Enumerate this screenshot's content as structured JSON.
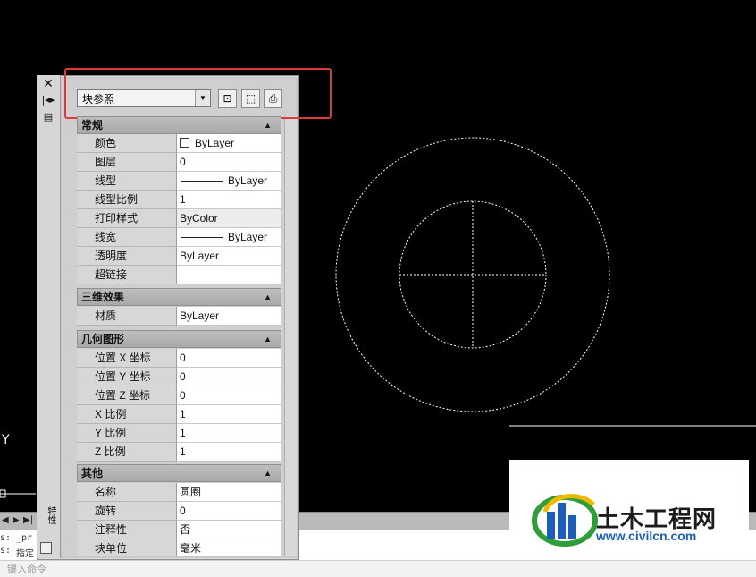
{
  "canvas": {
    "axis_label": "Y"
  },
  "palette": {
    "vertical_title": "特性",
    "object_type_select": "块参照",
    "toolbar": {
      "quick_select_icon": "quick-select-icon",
      "select_objects_icon": "select-objects-icon",
      "toggle_pickadd_icon": "toggle-pickadd-icon"
    },
    "sections": [
      {
        "title": "常规",
        "rows": [
          {
            "name": "颜色",
            "value": "ByLayer"
          },
          {
            "name": "图层",
            "value": "0"
          },
          {
            "name": "线型",
            "value": "ByLayer"
          },
          {
            "name": "线型比例",
            "value": "1"
          },
          {
            "name": "打印样式",
            "value": "ByColor"
          },
          {
            "name": "线宽",
            "value": "ByLayer"
          },
          {
            "name": "透明度",
            "value": "ByLayer"
          },
          {
            "name": "超链接",
            "value": ""
          }
        ]
      },
      {
        "title": "三维效果",
        "rows": [
          {
            "name": "材质",
            "value": "ByLayer"
          }
        ]
      },
      {
        "title": "几何图形",
        "rows": [
          {
            "name": "位置 X 坐标",
            "value": "0"
          },
          {
            "name": "位置 Y 坐标",
            "value": "0"
          },
          {
            "name": "位置 Z 坐标",
            "value": "0"
          },
          {
            "name": "X 比例",
            "value": "1"
          },
          {
            "name": "Y 比例",
            "value": "1"
          },
          {
            "name": "Z 比例",
            "value": "1"
          }
        ]
      },
      {
        "title": "其他",
        "rows": [
          {
            "name": "名称",
            "value": "圆圈"
          },
          {
            "name": "旋转",
            "value": "0"
          },
          {
            "name": "注释性",
            "value": "否"
          },
          {
            "name": "块单位",
            "value": "毫米"
          }
        ]
      }
    ]
  },
  "command": {
    "line1_prefix": "s:",
    "line1_text": "_pr",
    "line2_prefix": "s:",
    "line2_text": "指定",
    "prompt": "键入命令"
  },
  "watermark": {
    "title": "土木工程网",
    "url": "www.civilcn.com"
  },
  "colors": {
    "highlight": "#d93a3a",
    "canvas": "#000000",
    "logo_blue": "#1b5fb8"
  }
}
